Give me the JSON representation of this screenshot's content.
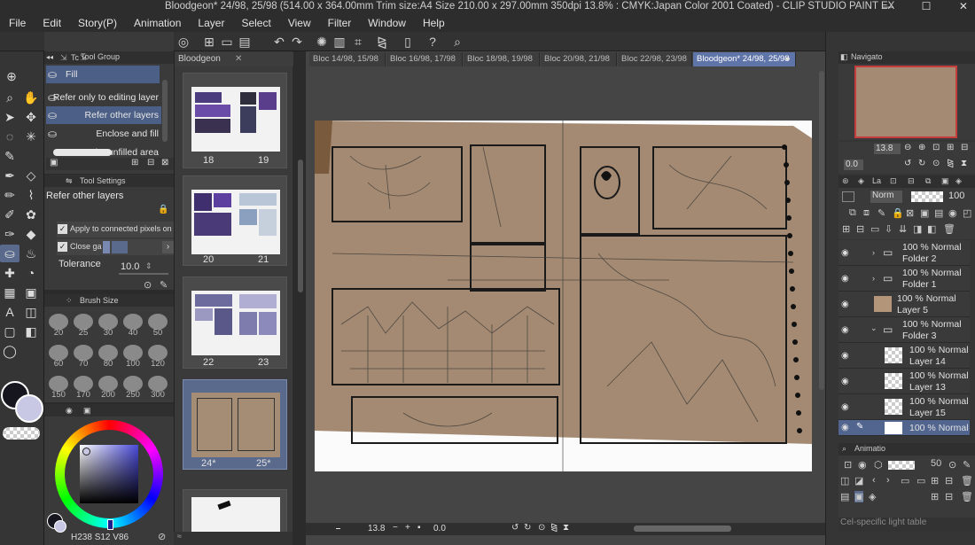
{
  "app": {
    "title": "Bloodgeon* 24/98, 25/98 (514.00 x 364.00mm Trim size:A4 Size 210.00 x 297.00mm 350dpi 13.8% : CMYK:Japan Color 2001 Coated)  - CLIP STUDIO PAINT EX"
  },
  "menu": [
    "File",
    "Edit",
    "Story(P)",
    "Animation",
    "Layer",
    "Select",
    "View",
    "Filter",
    "Window",
    "Help"
  ],
  "tool_group": {
    "header": "Tool Group",
    "tab": "Tc",
    "items": [
      "Fill",
      "Refer only to editing layer",
      "Refer other layers",
      "Enclose and fill",
      "Paint unfilled area"
    ]
  },
  "tool_settings": {
    "header": "Tool Settings",
    "subtool_name": "Refer other layers",
    "apply_connected": "Apply to connected pixels on",
    "close_gap": "Close ga",
    "tolerance_label": "Tolerance",
    "tolerance_value": "10.0"
  },
  "brush_size": {
    "header": "Brush Size",
    "sizes": [
      "20",
      "25",
      "30",
      "40",
      "50",
      "60",
      "70",
      "80",
      "100",
      "120",
      "150",
      "170",
      "200",
      "250",
      "300"
    ]
  },
  "color": {
    "main": "#16161f",
    "sub": "#c8c8e4",
    "hsv_h": "238",
    "hsv_s": "12",
    "hsv_v": "86",
    "h_label": "H",
    "s_label": "S",
    "v_label": "V"
  },
  "pages": {
    "project_tab": "Bloodgeon",
    "spreads": [
      {
        "left": "18",
        "right": "19"
      },
      {
        "left": "20",
        "right": "21"
      },
      {
        "left": "22",
        "right": "23"
      },
      {
        "left": "24*",
        "right": "25*"
      }
    ]
  },
  "doc_tabs": [
    "Bloc 14/98, 15/98",
    "Bloc 16/98, 17/98",
    "Bloc 18/98, 19/98",
    "Bloc 20/98, 21/98",
    "Bloc 22/98, 23/98",
    "Bloodgeon* 24/98, 25/98"
  ],
  "statusbar": {
    "zoom": "13.8",
    "angle": "0.0"
  },
  "navigator": {
    "header": "Navigato",
    "zoom": "13.8",
    "angle": "0.0"
  },
  "layers": {
    "tab": "La",
    "blend": "Norm",
    "opacity": "100",
    "rows": [
      {
        "pct": "100 % Normal",
        "name": "Folder 2",
        "type": "folder"
      },
      {
        "pct": "100 % Normal",
        "name": "Folder 1",
        "type": "folder"
      },
      {
        "pct": "100 % Normal",
        "name": "Layer 5",
        "type": "paper"
      },
      {
        "pct": "100 % Normal",
        "name": "Folder 3",
        "type": "folder-open"
      },
      {
        "pct": "100 % Normal",
        "name": "Layer 14",
        "type": "raster"
      },
      {
        "pct": "100 % Normal",
        "name": "Layer 13",
        "type": "raster"
      },
      {
        "pct": "100 % Normal",
        "name": "Layer 15",
        "type": "raster"
      },
      {
        "pct": "100 % Normal",
        "name": "",
        "type": "raster-selected"
      }
    ]
  },
  "animation": {
    "header": "Animatio",
    "value": "50",
    "footer": "Cel-specific light table"
  }
}
